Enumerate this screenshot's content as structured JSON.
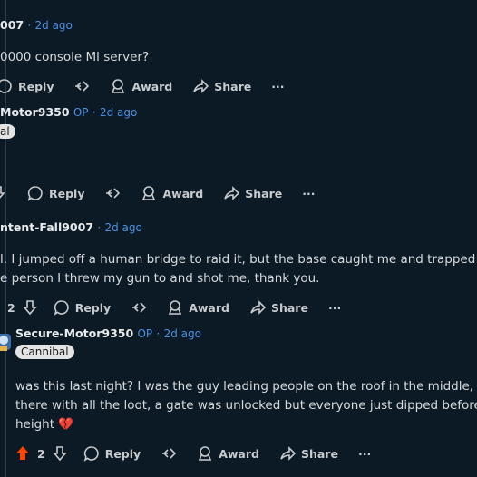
{
  "comments": [
    {
      "user": "007",
      "time": "2d ago",
      "body": "0000 console Ml server?",
      "actions": {
        "reply": "Reply",
        "award": "Award",
        "share": "Share",
        "more": "···"
      }
    },
    {
      "user": "Motor9350",
      "op": "OP",
      "time": "2d ago",
      "flair": "al",
      "actions": {
        "reply": "Reply",
        "award": "Award",
        "share": "Share",
        "more": "···"
      }
    },
    {
      "user": "ntent-Fall9007",
      "time": "2d ago",
      "body_lines": [
        "l. I jumped off a human bridge to raid it, but the base caught me and trapped me",
        "e person I threw my gun to and shot me, thank you."
      ],
      "votes": "2",
      "actions": {
        "reply": "Reply",
        "award": "Award",
        "share": "Share",
        "more": "···"
      }
    },
    {
      "user": "Secure-Motor9350",
      "op": "OP",
      "time": "2d ago",
      "flair": "Cannibal",
      "body_lines": [
        "was this last night? I was the guy leading people on the roof in the middle, I al",
        "there with all the loot, a gate was unlocked but everyone just dipped before I g",
        "height 💔"
      ],
      "votes": "2",
      "actions": {
        "reply": "Reply",
        "award": "Award",
        "share": "Share",
        "more": "···"
      }
    }
  ],
  "colors": {
    "background": "#0c1a26",
    "link": "#4a90e2",
    "upvote": "#ff4500",
    "flair_bg": "#e4e4e4"
  }
}
